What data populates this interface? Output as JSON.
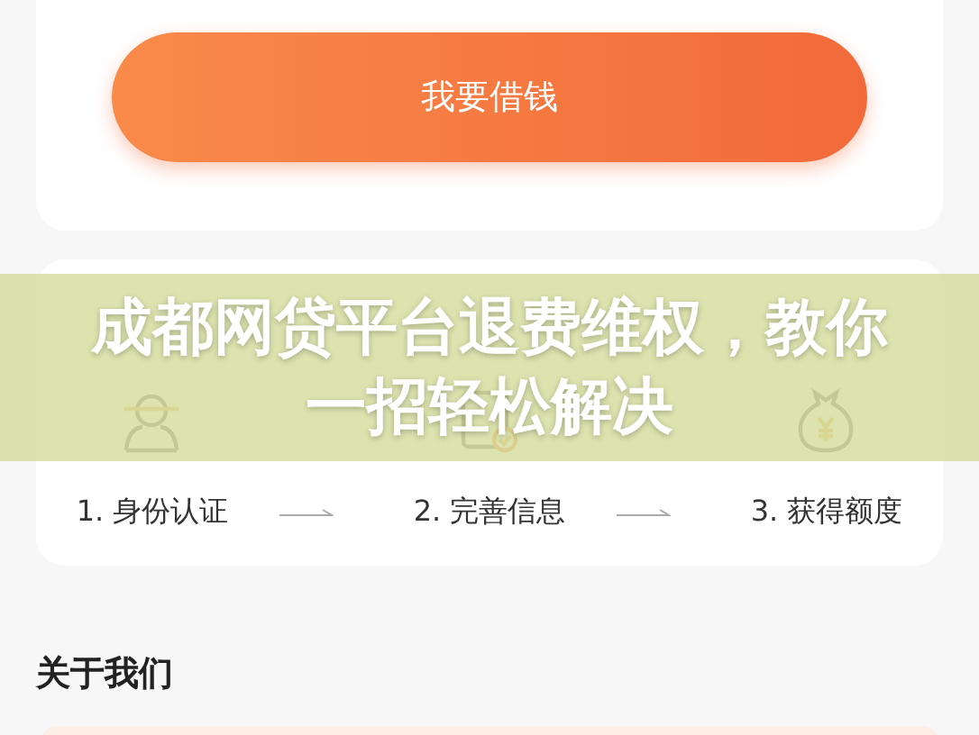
{
  "loan_button": {
    "label": "我要借钱"
  },
  "steps": [
    {
      "label": "1. 身份认证",
      "kind": "person"
    },
    {
      "label": "2. 完善信息",
      "kind": "form"
    },
    {
      "label": "3. 获得额度",
      "kind": "money"
    }
  ],
  "about": {
    "title": "关于我们"
  },
  "overlay_title": "成都网贷平台退费维权，教你一招轻松解决"
}
